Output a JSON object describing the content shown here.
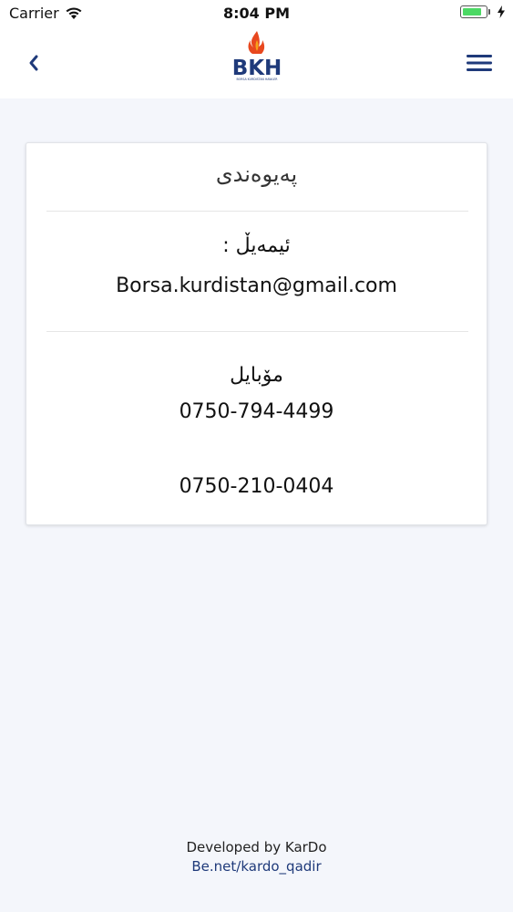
{
  "status_bar": {
    "carrier": "Carrier",
    "time": "8:04 PM",
    "battery_level": 0.85,
    "icons": [
      "wifi-icon",
      "battery-icon",
      "charging-bolt-icon"
    ]
  },
  "nav": {
    "logo_text": "BKH",
    "logo_subtext": "BORSA KURDISTAN HAWLER",
    "back_icon": "chevron-left-icon",
    "menu_icon": "hamburger-menu-icon",
    "accent_color": "#1f3a7a",
    "flame_color": "#e8481f"
  },
  "contact": {
    "title": "پەیوەندی",
    "email_label": "ئیمەیڵ :",
    "email": "Borsa.kurdistan@gmail.com",
    "mobile_label": "مۆبایل",
    "phones": [
      "0750-794-4499",
      "0750-210-0404"
    ]
  },
  "footer": {
    "developed_by": "Developed by KarDo",
    "link": "Be.net/kardo_qadir",
    "link_color": "#1f3a7a"
  }
}
